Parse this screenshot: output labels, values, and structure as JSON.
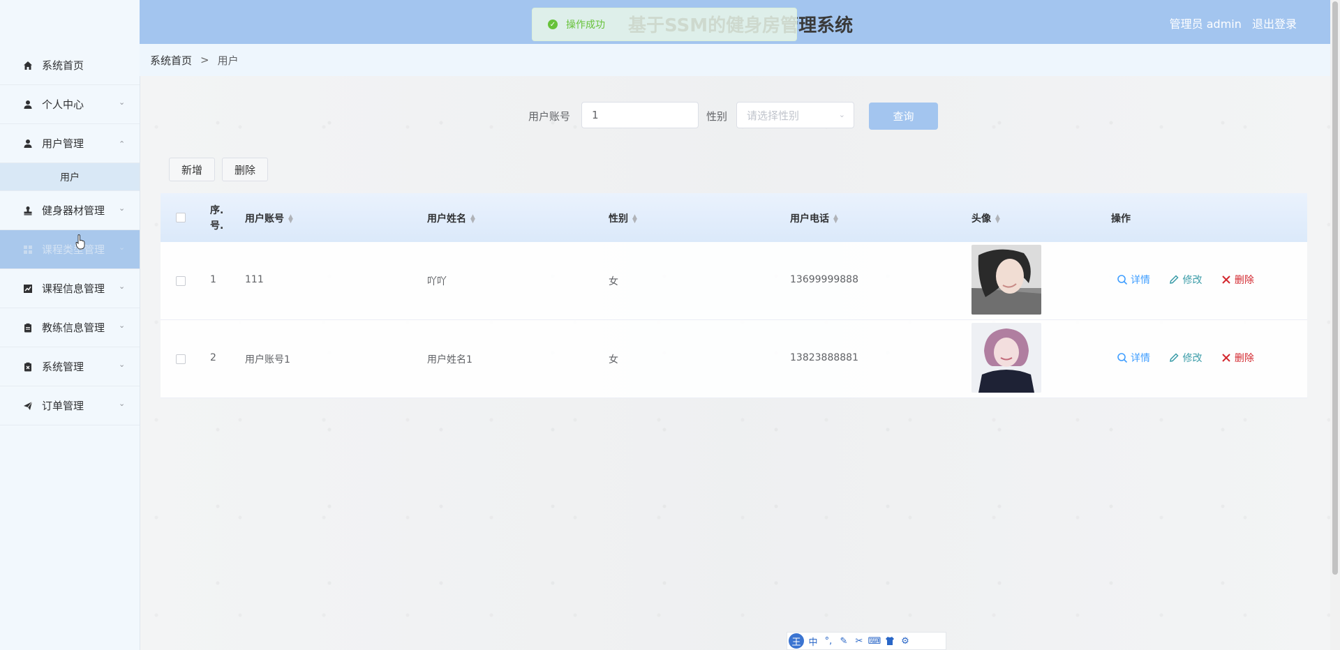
{
  "header": {
    "title": "基于SSM的健身房管理系统",
    "role": "管理员 admin",
    "logout": "退出登录",
    "toast": "操作成功"
  },
  "sidebar": {
    "items": [
      {
        "label": "系统首页",
        "icon": "home-icon"
      },
      {
        "label": "个人中心",
        "icon": "person-icon"
      },
      {
        "label": "用户管理",
        "icon": "person-icon"
      },
      {
        "label": "健身器材管理",
        "icon": "stamp-icon"
      },
      {
        "label": "课程类型管理",
        "icon": "grid-icon"
      },
      {
        "label": "课程信息管理",
        "icon": "chart-icon"
      },
      {
        "label": "教练信息管理",
        "icon": "clipboard-icon"
      },
      {
        "label": "系统管理",
        "icon": "clipboard-x-icon"
      },
      {
        "label": "订单管理",
        "icon": "send-icon"
      }
    ],
    "sub_user": "用户"
  },
  "breadcrumb": {
    "home": "系统首页",
    "sep": ">",
    "current": "用户"
  },
  "search": {
    "account_label": "用户账号",
    "account_value": "1",
    "gender_label": "性别",
    "gender_placeholder": "请选择性别",
    "query_button": "查询"
  },
  "toolbar": {
    "add": "新增",
    "delete": "删除"
  },
  "table": {
    "headers": {
      "index": "序.号.",
      "index_a": "序.",
      "index_b": "号.",
      "account": "用户账号",
      "name": "用户姓名",
      "gender": "性别",
      "phone": "用户电话",
      "avatar": "头像",
      "ops": "操作"
    },
    "rows": [
      {
        "index": "1",
        "account": "111",
        "name": "吖吖",
        "gender": "女",
        "phone": "13699999888"
      },
      {
        "index": "2",
        "account": "用户账号1",
        "name": "用户姓名1",
        "gender": "女",
        "phone": "13823888881"
      }
    ],
    "actions": {
      "detail": "详情",
      "edit": "修改",
      "remove": "删除"
    }
  },
  "ime": {
    "logo": "王",
    "mode": "中",
    "punct": "°,"
  },
  "colors": {
    "header": "#a3c5ef",
    "accent": "#409eff",
    "danger": "#d3272e",
    "success": "#67c23a"
  }
}
